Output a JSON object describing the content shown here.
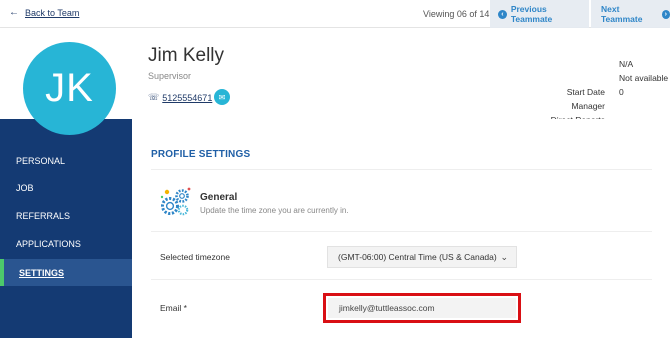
{
  "topbar": {
    "back_label": "Back to Team",
    "viewing": "Viewing 06 of 14",
    "prev_label": "Previous Teammate",
    "next_label": "Next Teammate"
  },
  "profile": {
    "initials": "JK",
    "name": "Jim Kelly",
    "role": "Supervisor",
    "phone": "5125554671",
    "meta_keys": [
      "Start Date",
      "Manager",
      "Direct Reports"
    ],
    "meta_values": [
      "N/A",
      "Not available",
      "0"
    ]
  },
  "sidebar": {
    "items": [
      {
        "label": "PERSONAL"
      },
      {
        "label": "JOB"
      },
      {
        "label": "REFERRALS"
      },
      {
        "label": "APPLICATIONS"
      },
      {
        "label": "SETTINGS",
        "active": true
      }
    ]
  },
  "settings": {
    "title": "PROFILE SETTINGS",
    "general_title": "General",
    "general_subtitle": "Update the time zone you are currently in.",
    "timezone_label": "Selected timezone",
    "timezone_value": "(GMT-06:00) Central Time (US & Canada)",
    "email_label": "Email *",
    "email_value": "jimkelly@tuttleassoc.com"
  },
  "colors": {
    "sidebar_bg": "#143a73",
    "active_bar": "#4cc96b",
    "accent": "#27b5d6",
    "link_blue": "#2f86c8",
    "highlight_red": "#d90f14"
  },
  "icons": [
    "arrow-left-icon",
    "chevron-left-icon",
    "chevron-right-icon",
    "phone-icon",
    "mail-icon",
    "gears-icon",
    "chevron-down-icon"
  ]
}
